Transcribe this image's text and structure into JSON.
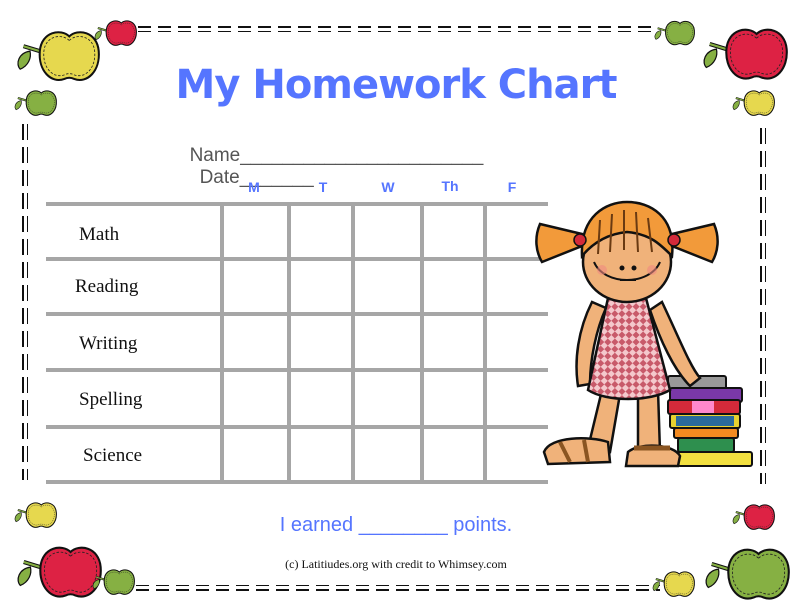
{
  "header": {
    "title": "My Homework Chart",
    "name_label": "Name_______________________",
    "date_label": "Date_______"
  },
  "chart": {
    "days": [
      "M",
      "T",
      "W",
      "Th",
      "F"
    ],
    "subjects": [
      "Math",
      "Reading",
      "Writing",
      "Spelling",
      "Science"
    ]
  },
  "footer": {
    "points_text": "I earned ________ points.",
    "credit": "(c) Latitiudes.org with credit to Whimsey.com"
  },
  "colors": {
    "title_blue": "#5575ff",
    "grid_gray": "#a6a6a6",
    "apple_red": "#dd2244",
    "apple_yellow": "#e6d84e",
    "apple_green": "#86b043"
  },
  "illustration": {
    "subject": "girl-with-books"
  }
}
